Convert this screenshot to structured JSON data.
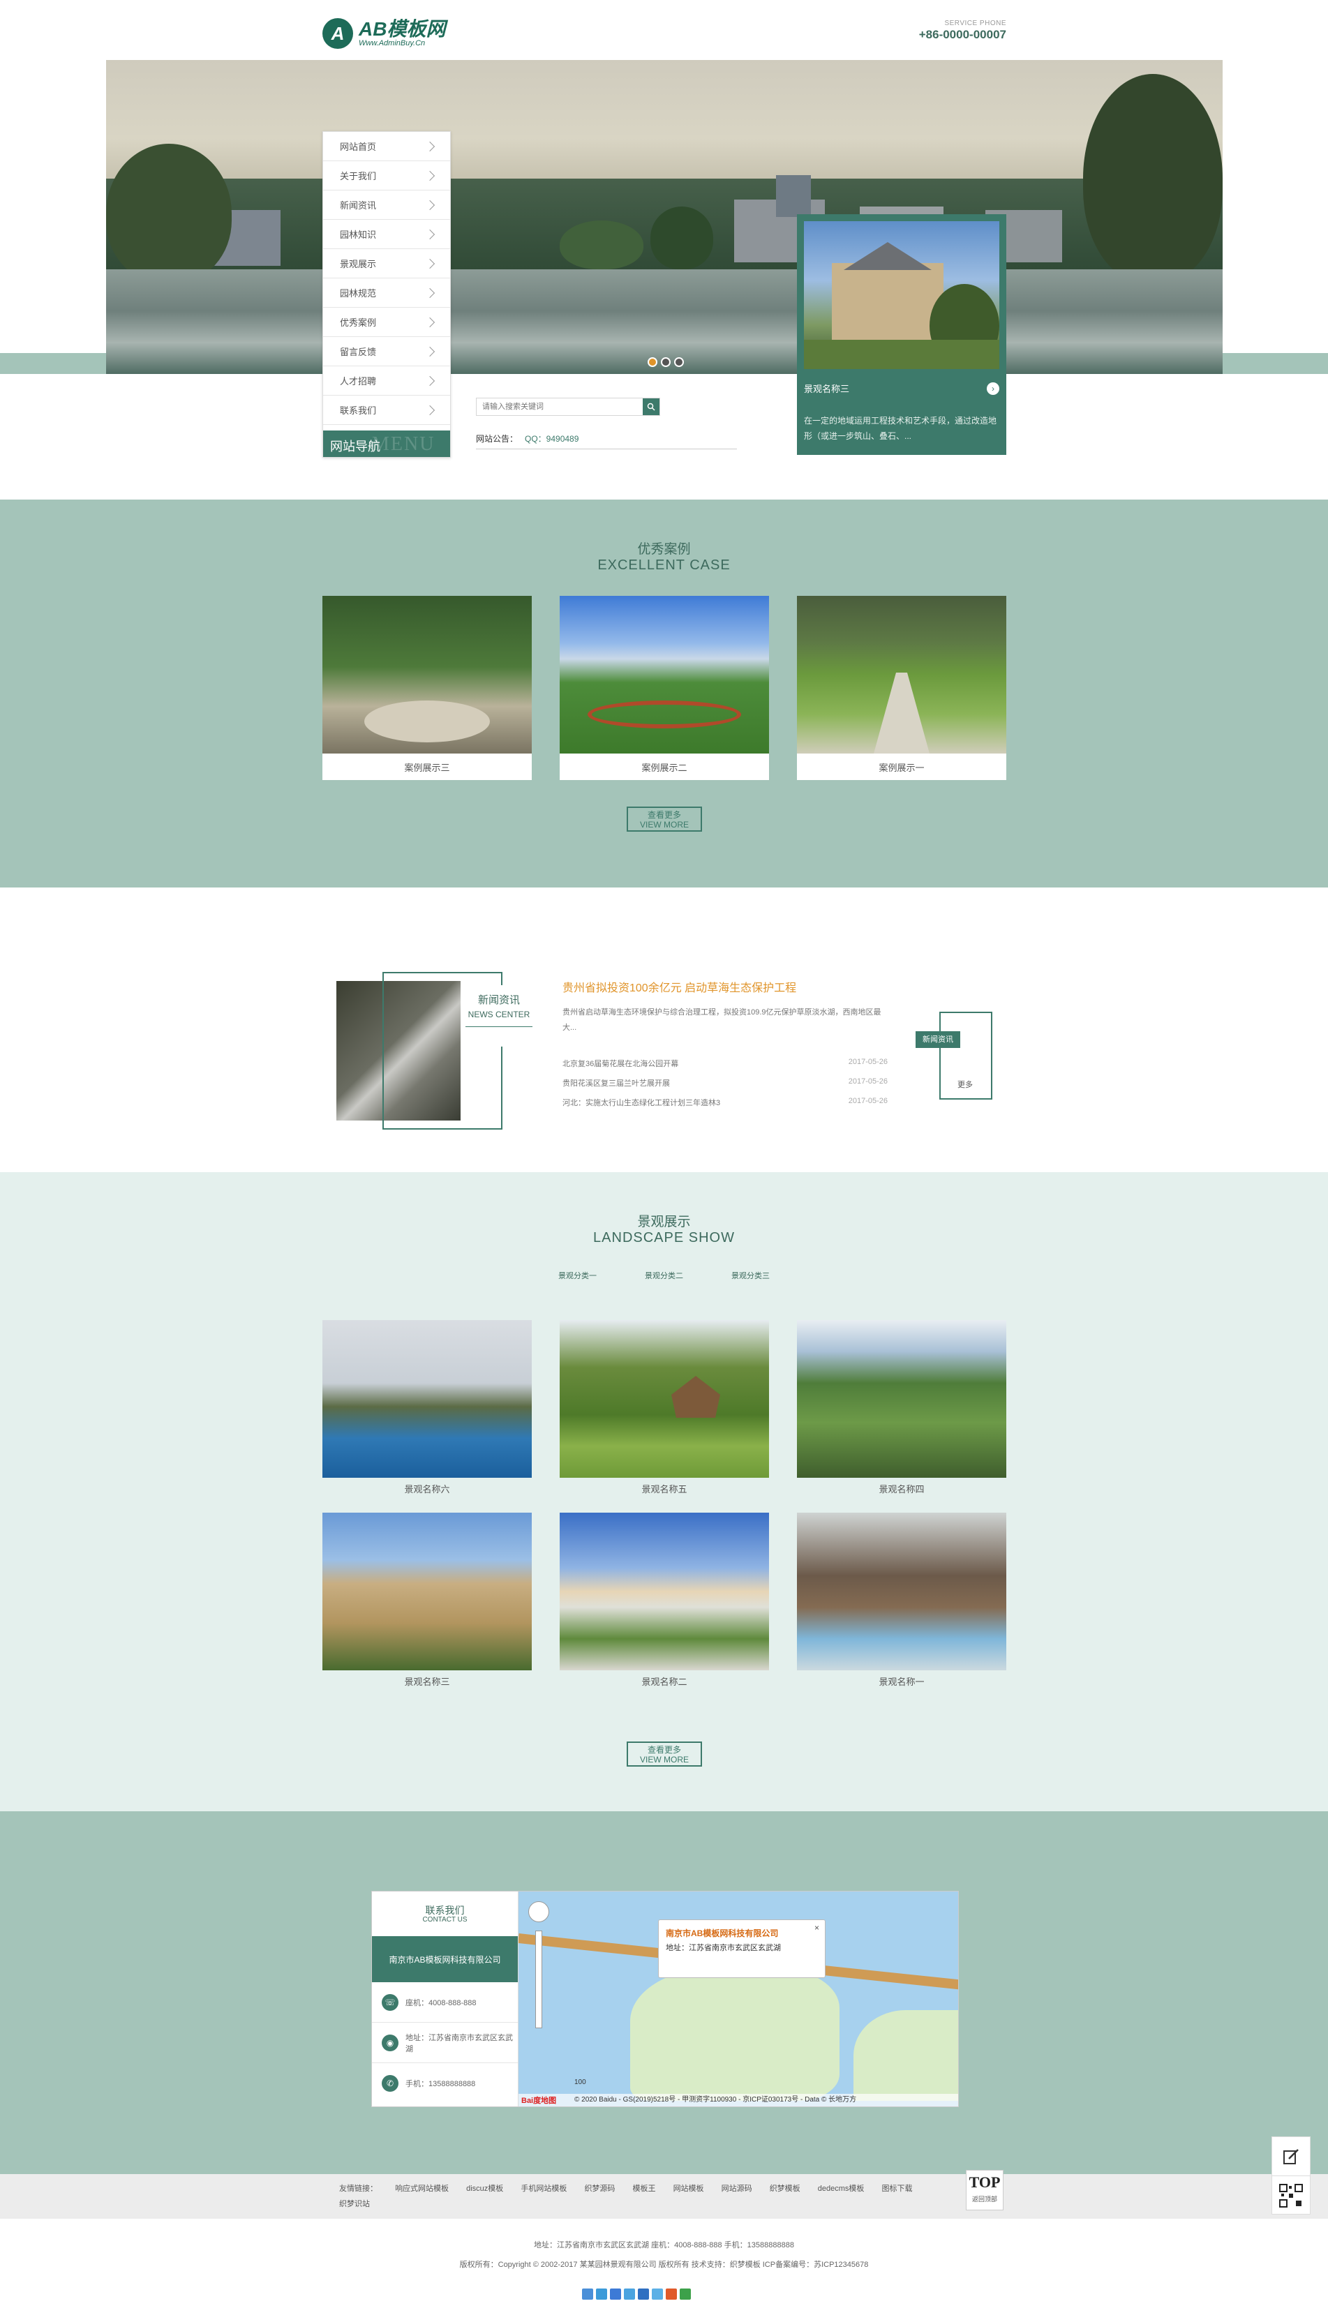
{
  "header": {
    "logo_text": "AB模板网",
    "logo_sub": "Www.AdminBuy.Cn",
    "phone_label": "SERVICE PHONE",
    "phone": "+86-0000-00007"
  },
  "nav": {
    "items": [
      "网站首页",
      "关于我们",
      "新闻资讯",
      "园林知识",
      "景观展示",
      "园林规范",
      "优秀案例",
      "留言反馈",
      "人才招聘",
      "联系我们"
    ],
    "footer": "网站导航",
    "footer_ghost": "MENU"
  },
  "search": {
    "placeholder": "请输入搜索关键词"
  },
  "notice": {
    "label": "网站公告：",
    "text": "QQ：9490489"
  },
  "feature": {
    "title": "景观名称三",
    "desc": "在一定的地域运用工程技术和艺术手段，通过改造地形（或进一步筑山、叠石、..."
  },
  "cases": {
    "title_cn": "优秀案例",
    "title_en": "EXCELLENT CASE",
    "items": [
      "案例展示三",
      "案例展示二",
      "案例展示一"
    ],
    "more_cn": "查看更多",
    "more_en": "VIEW MORE"
  },
  "news": {
    "label_cn": "新闻资讯",
    "label_en": "NEWS CENTER",
    "headline": "贵州省拟投资100余亿元 启动草海生态保护工程",
    "lead": "贵州省启动草海生态环境保护与综合治理工程，拟投资109.9亿元保护草原淡水湖，西南地区最大...",
    "list": [
      {
        "title": "北京复36届菊花展在北海公园开幕",
        "date": "2017-05-26"
      },
      {
        "title": "贵阳花溪区复三届兰叶艺展开展",
        "date": "2017-05-26"
      },
      {
        "title": "河北：实施太行山生态绿化工程计划三年造林3",
        "date": "2017-05-26"
      }
    ],
    "tag": "新闻资讯",
    "more": "更多"
  },
  "landscape": {
    "title_cn": "景观展示",
    "title_en": "LANDSCAPE SHOW",
    "tabs": [
      "景观分类一",
      "景观分类二",
      "景观分类三"
    ],
    "items": [
      "景观名称六",
      "景观名称五",
      "景观名称四",
      "景观名称三",
      "景观名称二",
      "景观名称一"
    ],
    "more_cn": "查看更多",
    "more_en": "VIEW MORE"
  },
  "contact": {
    "title_cn": "联系我们",
    "title_en": "CONTACT US",
    "company": "南京市AB模板网科技有限公司",
    "rows": [
      {
        "icon": "phone-icon",
        "text": "座机：4008-888-888"
      },
      {
        "icon": "location-icon",
        "text": "地址：江苏省南京市玄武区玄武湖"
      },
      {
        "icon": "mobile-icon",
        "text": "手机：13588888888"
      }
    ],
    "map_popup_company": "南京市AB模板网科技有限公司",
    "map_popup_addr": "地址：江苏省南京市玄武区玄武湖",
    "map_copyright": "© 2020 Baidu - GS(2019)5218号 - 甲测资字1100930 - 京ICP证030173号 - Data © 长地万方",
    "map_scale": "100",
    "map_logo": "Bai度地图"
  },
  "links": {
    "label": "友情链接：",
    "items": [
      "响应式网站模板",
      "discuz模板",
      "手机网站模板",
      "织梦源码",
      "模板王",
      "网站模板",
      "网站源码",
      "织梦模板",
      "dedecms模板",
      "图标下载",
      "织梦识站"
    ]
  },
  "top_button": {
    "label": "TOP",
    "sub": "返回顶部"
  },
  "footer": {
    "address": "地址：江苏省南京市玄武区玄武湖   座机：4008-888-888   手机：13588888888",
    "copyright": "版权所有：Copyright © 2002-2017 某某园林景观有限公司 版权所有   技术支持：织梦模板   ICP备案编号：苏ICP12345678"
  },
  "colors": {
    "brand": "#3d7a6b",
    "light_band": "#a4c4b9",
    "pale_band": "#e4f0ed",
    "accent": "#e0942a"
  }
}
